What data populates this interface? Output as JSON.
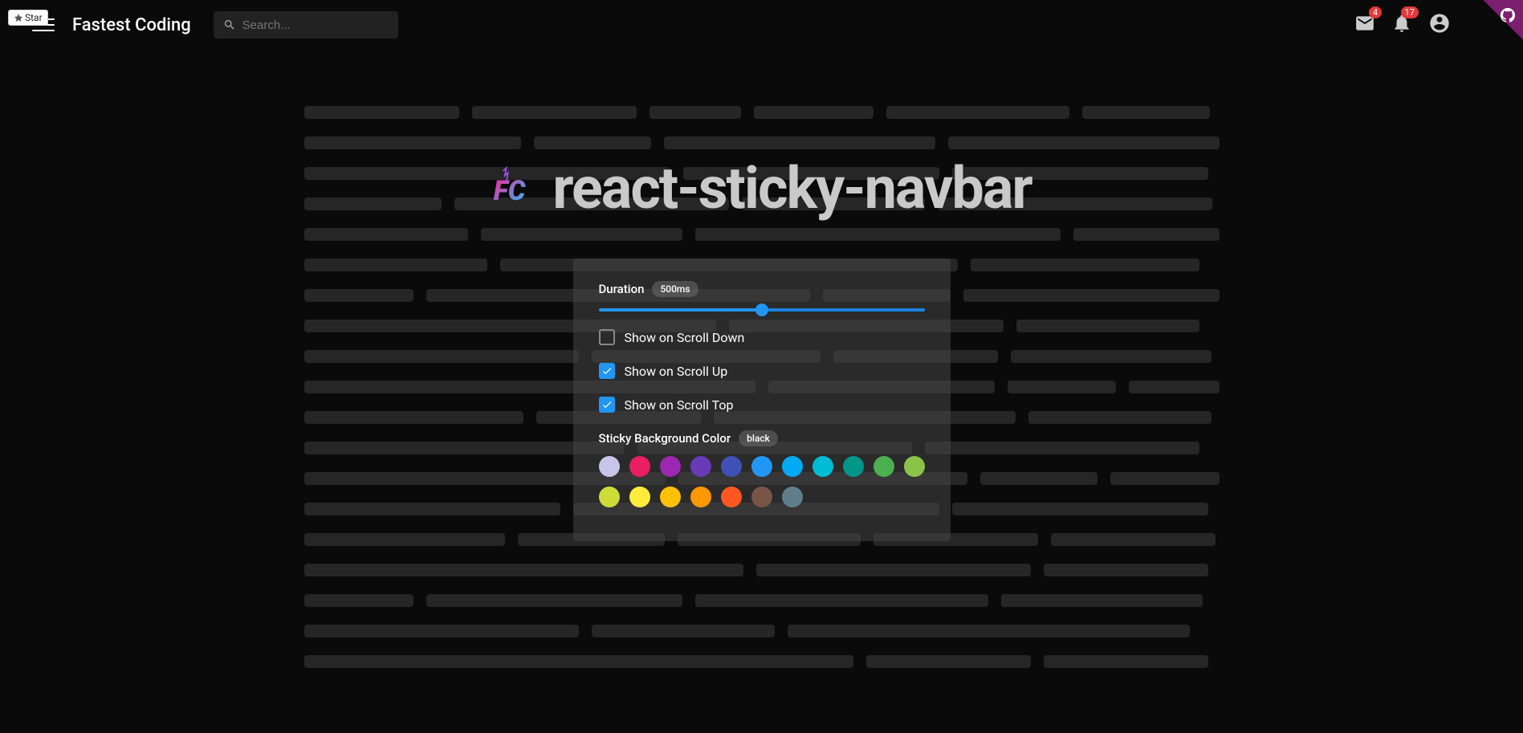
{
  "star": {
    "label": "Star"
  },
  "header": {
    "brand": "Fastest Coding",
    "search_placeholder": "Search...",
    "mail_badge": "4",
    "bell_badge": "17"
  },
  "hero": {
    "title": "react-sticky-navbar"
  },
  "panel": {
    "duration_label": "Duration",
    "duration_value": "500ms",
    "slider_percent": 50,
    "checkboxes": [
      {
        "label": "Show on Scroll Down",
        "checked": false
      },
      {
        "label": "Show on Scroll Up",
        "checked": true
      },
      {
        "label": "Show on Scroll Top",
        "checked": true
      }
    ],
    "bg_label": "Sticky Background Color",
    "bg_value": "black",
    "colors": [
      "#c9c5ea",
      "#e91e63",
      "#9c27b0",
      "#673ab7",
      "#3f51b5",
      "#2196f3",
      "#03a9f4",
      "#00bcd4",
      "#009688",
      "#4caf50",
      "#8bc34a",
      "#cddc39",
      "#ffeb3b",
      "#ffc107",
      "#ff9800",
      "#ff5722",
      "#795548",
      "#607d8b"
    ]
  },
  "skeleton_rows": [
    [
      17,
      18,
      10,
      13,
      20,
      14
    ],
    [
      24,
      13,
      30,
      30
    ],
    [
      40,
      28,
      28
    ],
    [
      15,
      30,
      20,
      30
    ],
    [
      18,
      22,
      40,
      16
    ],
    [
      20,
      50,
      25
    ],
    [
      12,
      42,
      14,
      28
    ],
    [
      45,
      30,
      20
    ],
    [
      30,
      25,
      18,
      22
    ],
    [
      50,
      25,
      12,
      10
    ],
    [
      24,
      18,
      33,
      20
    ],
    [
      35,
      30,
      30
    ],
    [
      40,
      32,
      13,
      12
    ],
    [
      28,
      40,
      28
    ],
    [
      22,
      16,
      20,
      18,
      18
    ],
    [
      48,
      30,
      18
    ],
    [
      12,
      28,
      32,
      22
    ],
    [
      30,
      20,
      44
    ],
    [
      60,
      18,
      18
    ]
  ]
}
